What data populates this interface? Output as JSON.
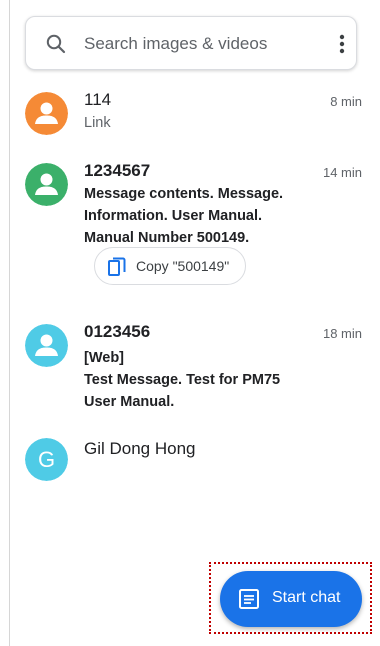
{
  "search": {
    "placeholder": "Search images & videos",
    "search_icon": "search-icon",
    "more_icon": "more-vert-icon"
  },
  "conversations": [
    {
      "name": "114",
      "snippet_lines": [
        "Link"
      ],
      "time": "8 min",
      "avatar_color": "#f58a36",
      "avatar_icon": "person-icon",
      "unread": false
    },
    {
      "name": "1234567",
      "snippet_lines": [
        "Message contents. Message.",
        "Information. User Manual.",
        "Manual Number 500149."
      ],
      "time": "14 min",
      "avatar_color": "#3bb06a",
      "avatar_icon": "person-icon",
      "unread": true,
      "suggestion": {
        "label": "Copy \"500149\"",
        "icon": "copy-icon"
      }
    },
    {
      "name": "0123456",
      "snippet_lines": [
        "[Web]",
        "Test Message. Test for PM75",
        "User Manual."
      ],
      "time": "18 min",
      "avatar_color": "#4fcbe6",
      "avatar_icon": "person-icon",
      "unread": true
    },
    {
      "name": "Gil Dong Hong",
      "avatar_letter": "G",
      "avatar_color": "#4fcbe6"
    }
  ],
  "fab": {
    "label": "Start chat",
    "icon": "chat-icon",
    "color": "#1a73e8"
  },
  "highlight_color": "#c00000"
}
